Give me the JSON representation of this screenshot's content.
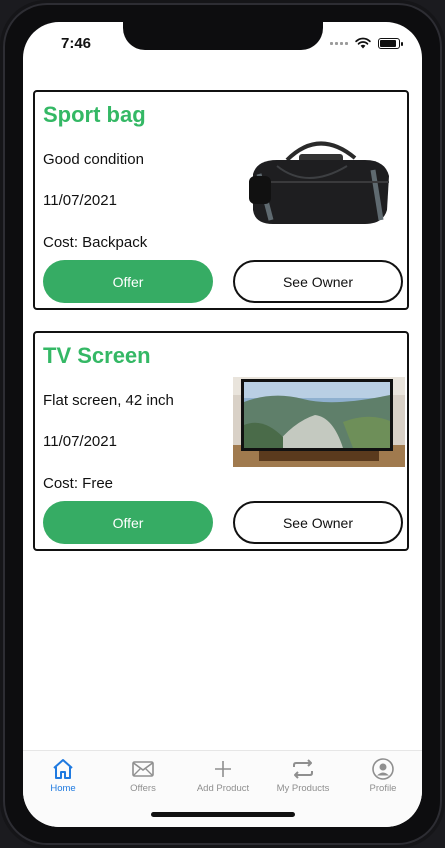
{
  "status_bar": {
    "time": "7:46"
  },
  "products": [
    {
      "title": "Sport bag",
      "description": "Good condition",
      "date": "11/07/2021",
      "cost": "Cost: Backpack",
      "offer_label": "Offer",
      "owner_label": "See Owner",
      "image": "duffel-bag-photo"
    },
    {
      "title": "TV Screen",
      "description": "Flat screen, 42 inch",
      "date": "11/07/2021",
      "cost": "Cost: Free",
      "offer_label": "Offer",
      "owner_label": "See Owner",
      "image": "tv-screen-photo"
    }
  ],
  "tabbar": {
    "tabs": [
      {
        "label": "Home",
        "icon": "home-icon",
        "active": true
      },
      {
        "label": "Offers",
        "icon": "envelope-icon",
        "active": false
      },
      {
        "label": "Add Product",
        "icon": "plus-icon",
        "active": false
      },
      {
        "label": "My Products",
        "icon": "swap-arrows-icon",
        "active": false
      },
      {
        "label": "Profile",
        "icon": "user-icon",
        "active": false
      }
    ]
  },
  "colors": {
    "title_green": "#34b865",
    "offer_button": "#36ac64",
    "active_tab": "#1f7ae0",
    "inactive_tab": "#8f8f8f"
  }
}
